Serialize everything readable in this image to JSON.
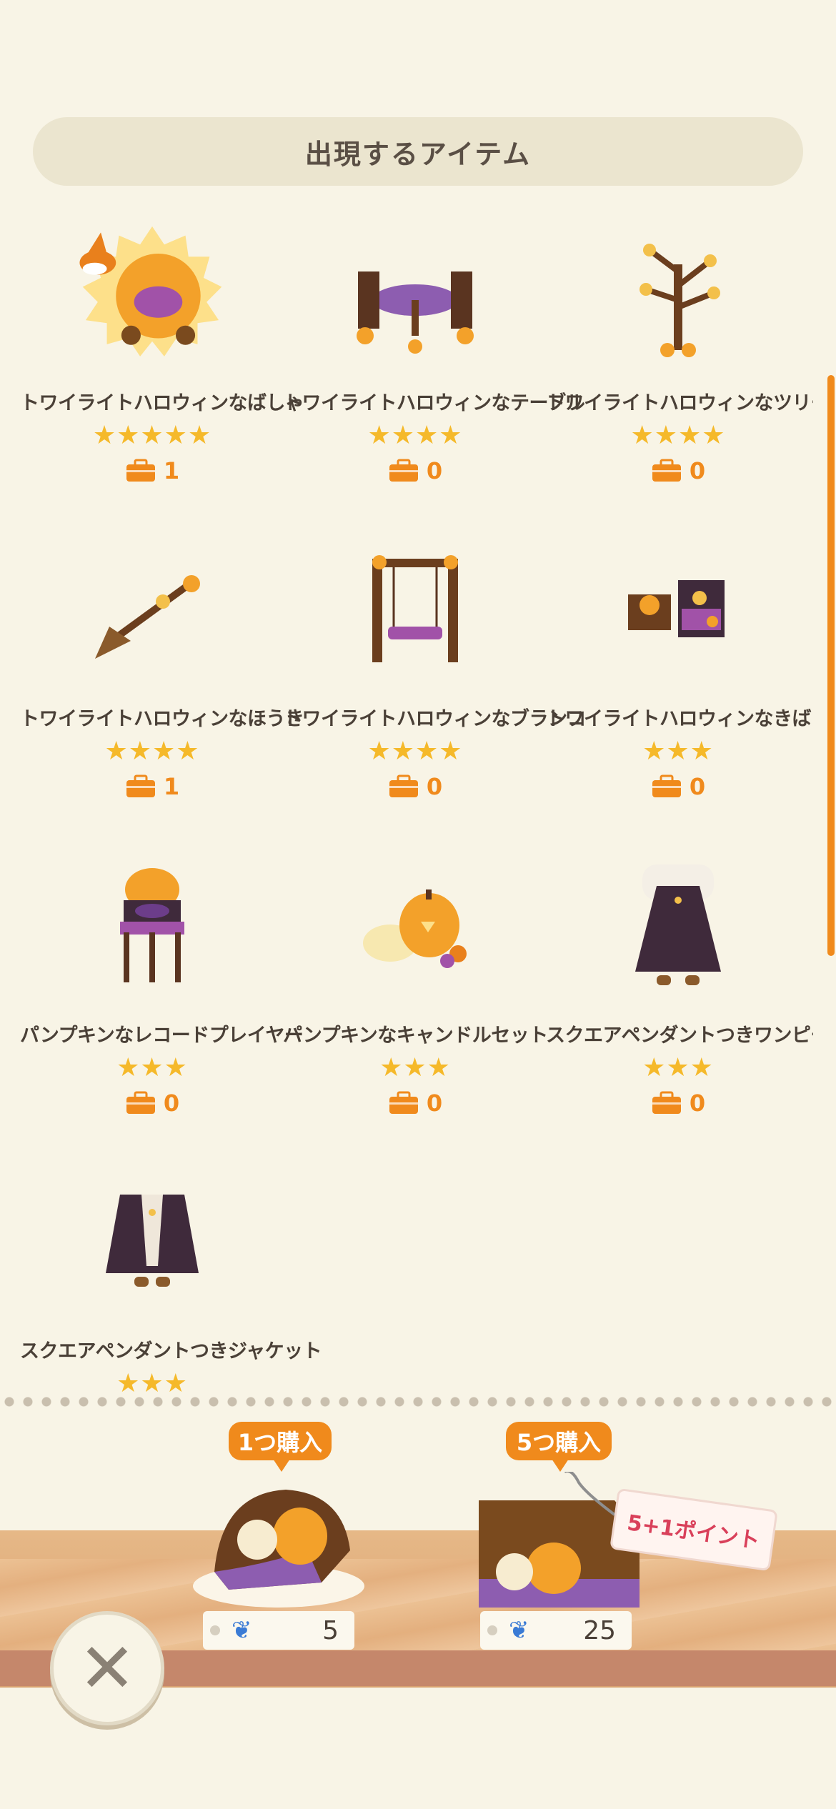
{
  "header": {
    "title": "出現するアイテム"
  },
  "items": [
    {
      "name": "トワイライトハロウィンなばしゃ",
      "stars": "★★★★★",
      "owned": "1"
    },
    {
      "name": "トワイライトハロウィンなテーブル",
      "stars": "★★★★",
      "owned": "0"
    },
    {
      "name": "トワイライトハロウィンなツリー",
      "stars": "★★★★",
      "owned": "0"
    },
    {
      "name": "トワイライトハロウィンなほうき",
      "stars": "★★★★",
      "owned": "1"
    },
    {
      "name": "トワイライトハロウィンなブランコ",
      "stars": "★★★★",
      "owned": "0"
    },
    {
      "name": "トワイライトハロウィンなきばこ",
      "stars": "★★★",
      "owned": "0"
    },
    {
      "name": "パンプキンなレコードプレイヤー",
      "stars": "★★★",
      "owned": "0"
    },
    {
      "name": "パンプキンなキャンドルセット",
      "stars": "★★★",
      "owned": "0"
    },
    {
      "name": "スクエアペンダントつきワンピース",
      "stars": "★★★",
      "owned": "0"
    },
    {
      "name": "スクエアペンダントつきジャケット",
      "stars": "★★★",
      "owned": ""
    }
  ],
  "purchase": {
    "single": {
      "label": "1つ購入",
      "price": "5"
    },
    "bundle": {
      "label": "5つ購入",
      "price": "25",
      "bonus": "5+1ポイント"
    }
  },
  "colors": {
    "accent": "#f08a1c",
    "star": "#f5b92a",
    "background": "#f8f4e6"
  }
}
